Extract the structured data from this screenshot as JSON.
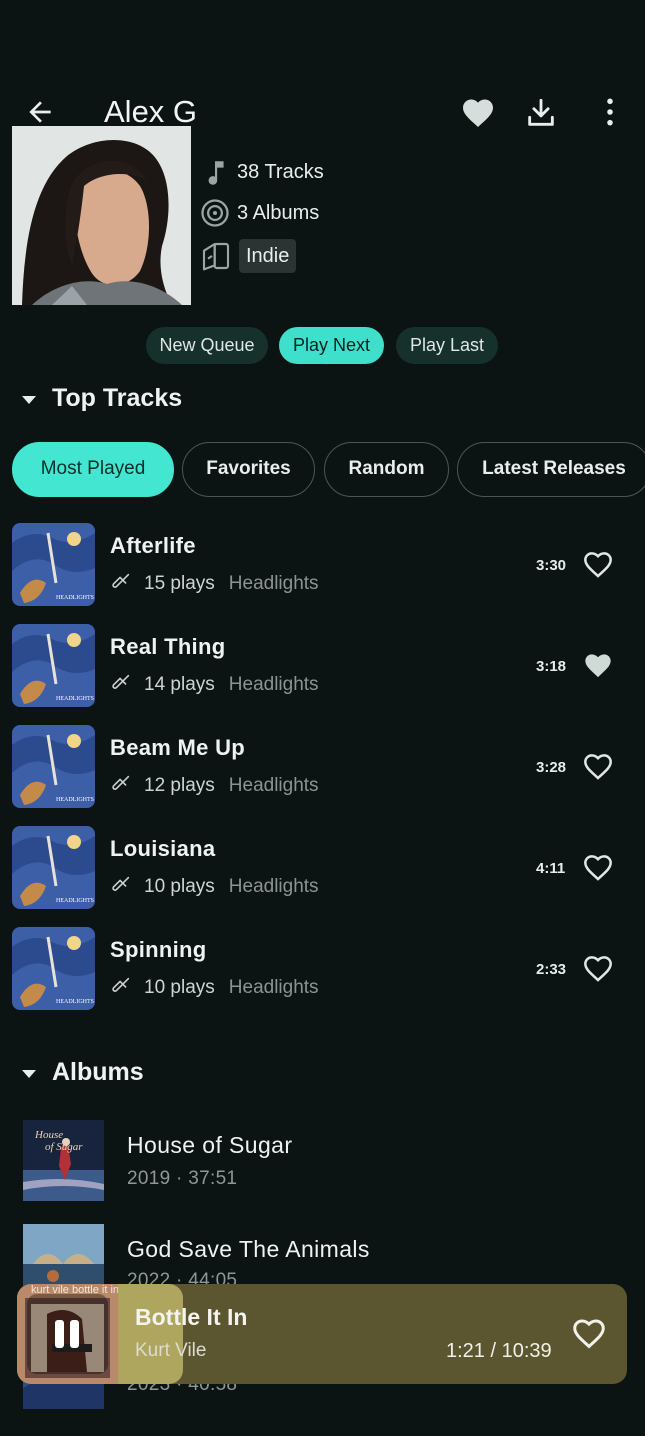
{
  "header": {
    "title": "Alex G"
  },
  "artist_info": {
    "tracks": "38 Tracks",
    "albums": "3 Albums",
    "genre": "Indie"
  },
  "queue_actions": {
    "new_queue": "New Queue",
    "play_next": "Play Next",
    "play_last": "Play Last"
  },
  "top_tracks": {
    "title": "Top Tracks",
    "filters": [
      "Most Played",
      "Favorites",
      "Random",
      "Latest Releases"
    ],
    "items": [
      {
        "title": "Afterlife",
        "plays": "15 plays",
        "album": "Headlights",
        "duration": "3:30",
        "favorite": false
      },
      {
        "title": "Real Thing",
        "plays": "14 plays",
        "album": "Headlights",
        "duration": "3:18",
        "favorite": true
      },
      {
        "title": "Beam Me Up",
        "plays": "12 plays",
        "album": "Headlights",
        "duration": "3:28",
        "favorite": false
      },
      {
        "title": "Louisiana",
        "plays": "10 plays",
        "album": "Headlights",
        "duration": "4:11",
        "favorite": false
      },
      {
        "title": "Spinning",
        "plays": "10 plays",
        "album": "Headlights",
        "duration": "2:33",
        "favorite": false
      }
    ]
  },
  "albums": {
    "title": "Albums",
    "items": [
      {
        "title": "House of Sugar",
        "subtitle": "2019 · 37:51"
      },
      {
        "title": "God Save The Animals",
        "subtitle": "2022 · 44:05"
      },
      {
        "title": "",
        "subtitle": "2023 · 40:58"
      }
    ]
  },
  "now_playing": {
    "title": "Bottle It In",
    "artist": "Kurt Vile",
    "time": "1:21 / 10:39",
    "cover_text": "kurt vile  bottle it in",
    "progress": 0.127,
    "color": "#5c5630"
  },
  "colors": {
    "accent": "#3ee0cb",
    "background": "#0c1413"
  }
}
